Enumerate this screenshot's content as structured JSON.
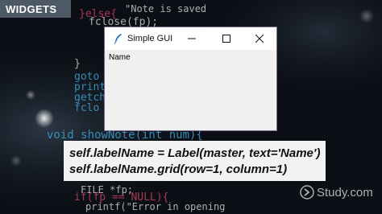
{
  "header": {
    "title": "WIDGETS"
  },
  "window": {
    "title": "Simple GUI",
    "icon": "feather-icon",
    "controls": [
      "minimize-icon",
      "maximize-icon",
      "close-icon"
    ],
    "label_text": "Name"
  },
  "caption": {
    "line1": "self.labelName = Label(master, text='Name')",
    "line2": "self.labelName.grid(row=1, column=1)"
  },
  "watermark": {
    "brand": "Study.com"
  },
  "background_code": [
    {
      "text": "}else{",
      "color": "#c0405a"
    },
    {
      "text": "fclose(fp);",
      "color": "#c8c8c8"
    },
    {
      "text": "}",
      "color": "#c8c8c8"
    },
    {
      "text": "goto",
      "color": "#3e9fd0"
    },
    {
      "text": "printf",
      "color": "#3e9fd0"
    },
    {
      "text": "getch",
      "color": "#3e9fd0"
    },
    {
      "text": "fclo",
      "color": "#3e9fd0"
    },
    {
      "text": "void  showNote(int num){",
      "color": "#3e9fd0"
    },
    {
      "text": "FILE *fp;",
      "color": "#c8c8c8"
    },
    {
      "text": "if(fp == NULL){",
      "color": "#c0405a"
    },
    {
      "text": "printf(\"Error in opening",
      "color": "#c8c8c8"
    },
    {
      "text": "\"Note is saved",
      "color": "#c8c8c8"
    }
  ],
  "colors": {
    "accent_pink": "#c0405a",
    "accent_blue": "#3e9fd0",
    "header_bar": "#4d5a66"
  }
}
